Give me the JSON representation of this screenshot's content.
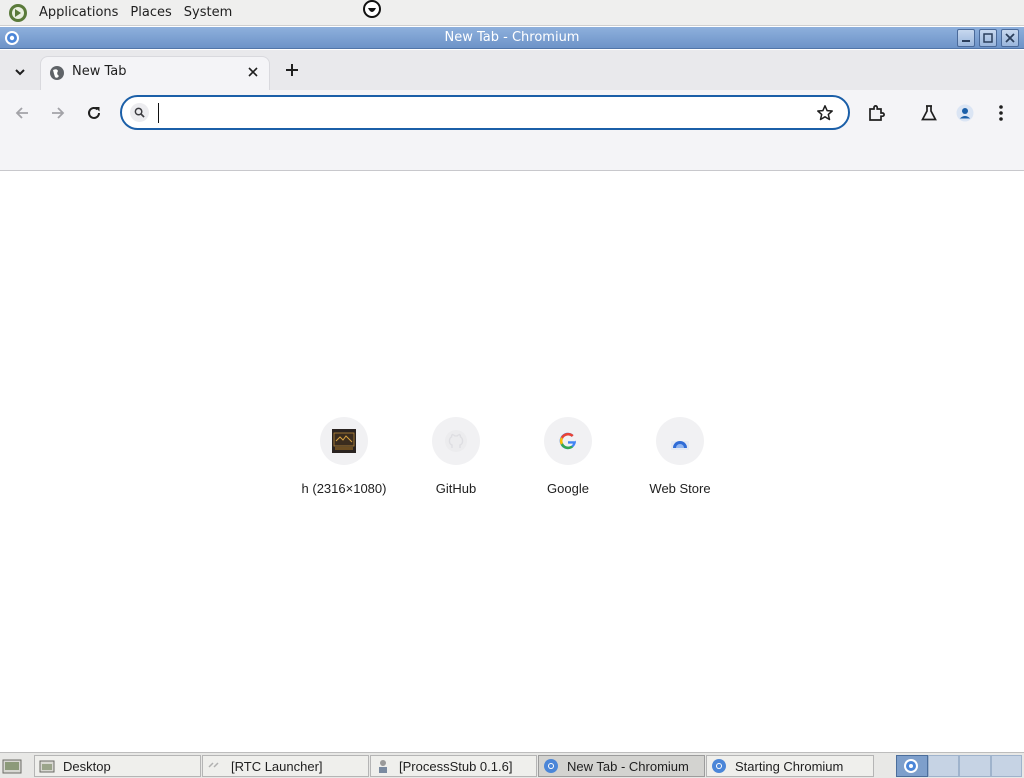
{
  "top_panel": {
    "menus": [
      "Applications",
      "Places",
      "System"
    ]
  },
  "window": {
    "title": "New Tab - Chromium"
  },
  "tabs": [
    {
      "title": "New Tab",
      "favicon": "globe-icon",
      "active": true
    }
  ],
  "toolbar": {
    "omnibox_value": "",
    "omnibox_placeholder": ""
  },
  "shortcuts": [
    {
      "label": "h (2316×1080)",
      "icon": "thumbnail-icon"
    },
    {
      "label": "GitHub",
      "icon": "github-icon"
    },
    {
      "label": "Google",
      "icon": "google-icon"
    },
    {
      "label": "Web Store",
      "icon": "web-store-icon"
    }
  ],
  "taskbar": {
    "tasks": [
      {
        "label": "Desktop",
        "icon": "folder-icon",
        "active": false
      },
      {
        "label": "[RTC Launcher]",
        "icon": "launcher-icon",
        "active": false
      },
      {
        "label": "[ProcessStub 0.1.6]",
        "icon": "process-icon",
        "active": false
      },
      {
        "label": "New Tab - Chromium",
        "icon": "chromium-icon",
        "active": true
      },
      {
        "label": "Starting Chromium",
        "icon": "chromium-icon",
        "active": false
      }
    ]
  },
  "colors": {
    "accent": "#1b5fa8",
    "titlebar": "#7aa0d2",
    "toolbar_bg": "#f4f4f7"
  }
}
